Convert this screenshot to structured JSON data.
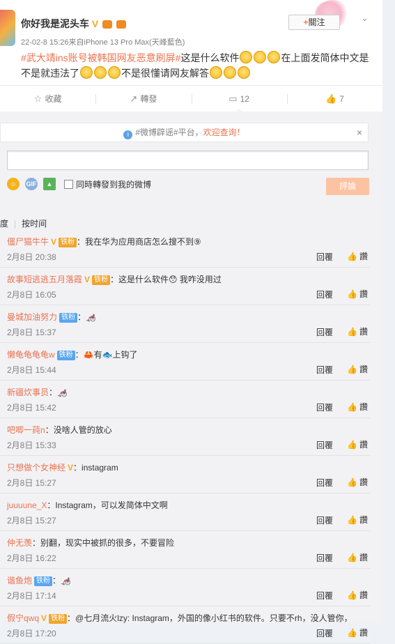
{
  "post": {
    "username": "你好我是泥头车",
    "verified_mark": "V",
    "meta": "22-02-8 15:26来自iPhone 13 Pro Max(天峰藍色)",
    "follow_plus": "+",
    "follow_label": "關注",
    "text_topic": "#武大靖ins账号被韩国网友恶意刷屏#",
    "text_part1": "这是什么软件",
    "text_part2": "在上面发简体中文是",
    "text_part3": "不是就违法了",
    "text_part4": "不是很懂请网友解答"
  },
  "actions": [
    {
      "icon": "☆",
      "label": "收藏"
    },
    {
      "icon": "↗",
      "label": "轉發"
    },
    {
      "icon": "▭",
      "label": "12"
    },
    {
      "icon": "👍",
      "label": "7"
    }
  ],
  "comment_panel": {
    "notice_prefix": "#微博辟谣#平台，",
    "notice_link": "欢迎查询！",
    "close": "×",
    "gif_label": "GIF",
    "repost_label": "同時轉發到我的微博",
    "submit_label": "評論",
    "sort_hot": "度",
    "sort_time": "按时间"
  },
  "comments": [
    {
      "nick": "僵尸猫牛牛",
      "v": "V",
      "tag": "铁粉",
      "tag_color": "gold",
      "text": "：我在华为应用商店怎么搜不到⑨",
      "time": "2月8日 20:38"
    },
    {
      "nick": "故事短逃逃五月落霞",
      "v": "V",
      "tag": "铁粉",
      "tag_color": "gold",
      "text": "：这是什么软件😯 我咋没用过",
      "time": "2月8日 16:05"
    },
    {
      "nick": "曼城加油努力",
      "v": "",
      "tag": "铁粉",
      "tag_color": "blue",
      "text": "：🦽",
      "time": "2月8日 15:37"
    },
    {
      "nick": "懒龟龟龟龟w",
      "v": "",
      "tag": "铁粉",
      "tag_color": "blue",
      "text": "：🦀有🐟上钩了",
      "time": "2月8日 15:44"
    },
    {
      "nick": "新疆炊事员",
      "v": "",
      "tag": "",
      "tag_color": "",
      "text": "：🦽",
      "time": "2月8日 15:42"
    },
    {
      "nick": "吧唧一莼n",
      "v": "",
      "tag": "",
      "tag_color": "",
      "text": "：没啥人管的放心",
      "time": "2月8日 15:33"
    },
    {
      "nick": "只想做个女神经",
      "v": "V",
      "tag": "",
      "tag_color": "",
      "text": "：instagram",
      "time": "2月8日 15:27"
    },
    {
      "nick": "juuuune_X",
      "v": "",
      "tag": "",
      "tag_color": "",
      "text": "：Instagram，可以发简体中文啊",
      "time": "2月8日 15:27"
    },
    {
      "nick": "仲无羡",
      "v": "",
      "tag": "",
      "tag_color": "",
      "text": "：别翻，现实中被抓的很多，不要冒险",
      "time": "2月8日 16:22"
    },
    {
      "nick": "谐鱼炮",
      "v": "",
      "tag": "铁粉",
      "tag_color": "blue",
      "text": "：🦽",
      "time": "2月8日 17:14"
    },
    {
      "nick": "假宁qwq",
      "v": "V",
      "tag": "铁粉",
      "tag_color": "gold",
      "text": "：@七月流火lzy: Instagram，外国的像小红书的软件。只要不rh，没人管你，",
      "time": "2月8日 17:20"
    }
  ],
  "reply_label": "回覆",
  "like_label": "讚"
}
